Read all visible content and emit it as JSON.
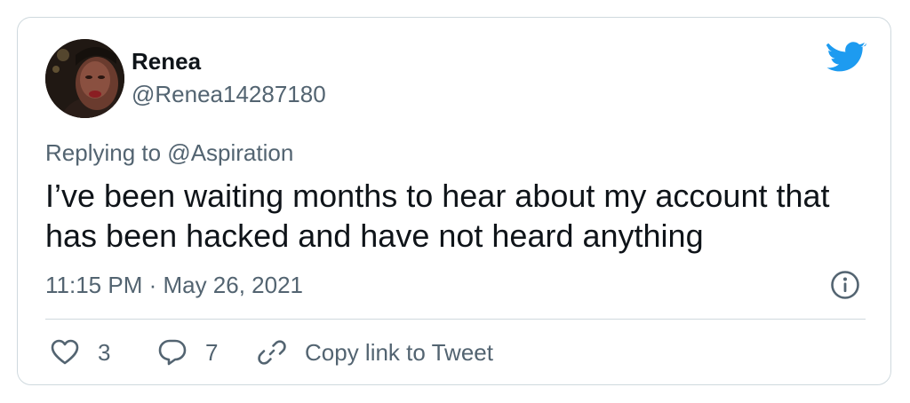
{
  "user": {
    "name": "Renea",
    "handle": "@Renea14287180"
  },
  "tweet": {
    "replying_to": "Replying to @Aspiration",
    "text": "I’ve been waiting months to hear about my account that has been hacked and have not heard anything",
    "timestamp": "11:15 PM · May 26, 2021"
  },
  "actions": {
    "likes": "3",
    "replies": "7",
    "copy_link_label": "Copy link to Tweet"
  },
  "icons": {
    "brand": "twitter-bird-icon",
    "info": "info-icon",
    "like": "heart-icon",
    "reply": "speech-bubble-icon",
    "copy": "link-icon"
  },
  "colors": {
    "brand": "#1d9bf0",
    "text_primary": "#0f1419",
    "text_secondary": "#536471",
    "border": "#cfd9de"
  }
}
